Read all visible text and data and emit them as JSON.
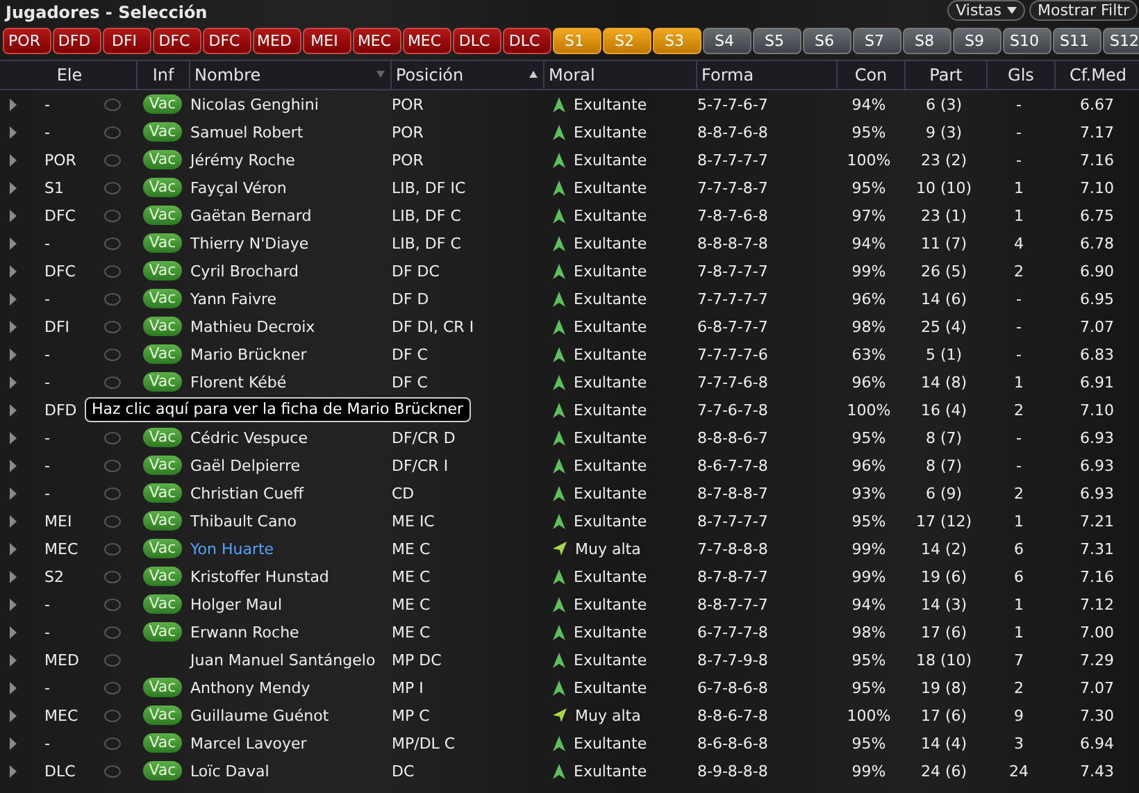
{
  "title": "Jugadores - Selección",
  "header_buttons": [
    {
      "label": "Vistas",
      "dropdown": true
    },
    {
      "label": "Mostrar Filtr",
      "dropdown": false
    }
  ],
  "slots": [
    {
      "label": "POR",
      "kind": "starter"
    },
    {
      "label": "DFD",
      "kind": "starter"
    },
    {
      "label": "DFI",
      "kind": "starter"
    },
    {
      "label": "DFC",
      "kind": "starter"
    },
    {
      "label": "DFC",
      "kind": "starter"
    },
    {
      "label": "MED",
      "kind": "starter"
    },
    {
      "label": "MEI",
      "kind": "starter"
    },
    {
      "label": "MEC",
      "kind": "starter"
    },
    {
      "label": "MEC",
      "kind": "starter"
    },
    {
      "label": "DLC",
      "kind": "starter"
    },
    {
      "label": "DLC",
      "kind": "starter"
    },
    {
      "label": "S1",
      "kind": "sub"
    },
    {
      "label": "S2",
      "kind": "sub"
    },
    {
      "label": "S3",
      "kind": "sub"
    },
    {
      "label": "S4",
      "kind": "empty"
    },
    {
      "label": "S5",
      "kind": "empty"
    },
    {
      "label": "S6",
      "kind": "empty"
    },
    {
      "label": "S7",
      "kind": "empty"
    },
    {
      "label": "S8",
      "kind": "empty"
    },
    {
      "label": "S9",
      "kind": "empty"
    },
    {
      "label": "S10",
      "kind": "empty"
    },
    {
      "label": "S11",
      "kind": "empty"
    },
    {
      "label": "S12",
      "kind": "empty"
    }
  ],
  "columns": [
    {
      "label": "Ele",
      "sorted": false
    },
    {
      "label": "Inf",
      "sorted": false
    },
    {
      "label": "Nombre",
      "sorted": true,
      "ascending": false
    },
    {
      "label": "Posición",
      "sorted": true,
      "ascending": true
    },
    {
      "label": "Moral",
      "sorted": false
    },
    {
      "label": "Forma",
      "sorted": false
    },
    {
      "label": "Con",
      "sorted": false
    },
    {
      "label": "Part",
      "sorted": false
    },
    {
      "label": "Gls",
      "sorted": false
    },
    {
      "label": "Cf.Med",
      "sorted": false
    }
  ],
  "rows": [
    {
      "ele": "-",
      "vac": "Vac",
      "name": "Nicolas Genghini",
      "highlighted": false,
      "position": "POR",
      "moral": {
        "kind": "up",
        "label": "Exultante"
      },
      "forma": "5-7-7-6-7",
      "con": "94%",
      "part": "6 (3)",
      "gls": "-",
      "cf": "6.67"
    },
    {
      "ele": "-",
      "vac": "Vac",
      "name": "Samuel Robert",
      "highlighted": false,
      "position": "POR",
      "moral": {
        "kind": "up",
        "label": "Exultante"
      },
      "forma": "8-8-7-6-8",
      "con": "95%",
      "part": "9 (3)",
      "gls": "-",
      "cf": "7.17"
    },
    {
      "ele": "POR",
      "vac": "Vac",
      "name": "Jérémy Roche",
      "highlighted": false,
      "position": "POR",
      "moral": {
        "kind": "up",
        "label": "Exultante"
      },
      "forma": "8-7-7-7-7",
      "con": "100%",
      "part": "23 (2)",
      "gls": "-",
      "cf": "7.16"
    },
    {
      "ele": "S1",
      "vac": "Vac",
      "name": "Fayçal Véron",
      "highlighted": false,
      "position": "LIB, DF IC",
      "moral": {
        "kind": "up",
        "label": "Exultante"
      },
      "forma": "7-7-7-8-7",
      "con": "95%",
      "part": "10 (10)",
      "gls": "1",
      "cf": "7.10"
    },
    {
      "ele": "DFC",
      "vac": "Vac",
      "name": "Gaëtan Bernard",
      "highlighted": false,
      "position": "LIB, DF C",
      "moral": {
        "kind": "up",
        "label": "Exultante"
      },
      "forma": "7-8-7-6-8",
      "con": "97%",
      "part": "23 (1)",
      "gls": "1",
      "cf": "6.75"
    },
    {
      "ele": "-",
      "vac": "Vac",
      "name": "Thierry N'Diaye",
      "highlighted": false,
      "position": "LIB, DF C",
      "moral": {
        "kind": "up",
        "label": "Exultante"
      },
      "forma": "8-8-8-7-8",
      "con": "94%",
      "part": "11 (7)",
      "gls": "4",
      "cf": "6.78"
    },
    {
      "ele": "DFC",
      "vac": "Vac",
      "name": "Cyril Brochard",
      "highlighted": false,
      "position": "DF DC",
      "moral": {
        "kind": "up",
        "label": "Exultante"
      },
      "forma": "7-8-7-7-7",
      "con": "99%",
      "part": "26 (5)",
      "gls": "2",
      "cf": "6.90"
    },
    {
      "ele": "-",
      "vac": "Vac",
      "name": "Yann Faivre",
      "highlighted": false,
      "position": "DF D",
      "moral": {
        "kind": "up",
        "label": "Exultante"
      },
      "forma": "7-7-7-7-7",
      "con": "96%",
      "part": "14 (6)",
      "gls": "-",
      "cf": "6.95"
    },
    {
      "ele": "DFI",
      "vac": "Vac",
      "name": "Mathieu Decroix",
      "highlighted": false,
      "position": "DF DI, CR I",
      "moral": {
        "kind": "up",
        "label": "Exultante"
      },
      "forma": "6-8-7-7-7",
      "con": "98%",
      "part": "25 (4)",
      "gls": "-",
      "cf": "7.07"
    },
    {
      "ele": "-",
      "vac": "Vac",
      "name": "Mario Brückner",
      "highlighted": false,
      "position": "DF C",
      "moral": {
        "kind": "up",
        "label": "Exultante"
      },
      "forma": "7-7-7-7-6",
      "con": "63%",
      "part": "5 (1)",
      "gls": "-",
      "cf": "6.83"
    },
    {
      "ele": "-",
      "vac": "Vac",
      "name": "Florent Kébé",
      "highlighted": false,
      "position": "DF C",
      "moral": {
        "kind": "up",
        "label": "Exultante"
      },
      "forma": "7-7-7-6-8",
      "con": "96%",
      "part": "14 (8)",
      "gls": "1",
      "cf": "6.91"
    },
    {
      "ele": "DFD",
      "tooltip": "Haz clic aquí para ver la ficha de Mario Brückner",
      "moral": {
        "kind": "up",
        "label": "Exultante"
      },
      "forma": "7-7-6-7-8",
      "con": "100%",
      "part": "16 (4)",
      "gls": "2",
      "cf": "7.10"
    },
    {
      "ele": "-",
      "vac": "Vac",
      "name": "Cédric Vespuce",
      "highlighted": false,
      "position": "DF/CR D",
      "moral": {
        "kind": "up",
        "label": "Exultante"
      },
      "forma": "8-8-8-6-7",
      "con": "95%",
      "part": "8 (7)",
      "gls": "-",
      "cf": "6.93"
    },
    {
      "ele": "-",
      "vac": "Vac",
      "name": "Gaël Delpierre",
      "highlighted": false,
      "position": "DF/CR I",
      "moral": {
        "kind": "up",
        "label": "Exultante"
      },
      "forma": "8-6-7-7-8",
      "con": "96%",
      "part": "8 (7)",
      "gls": "-",
      "cf": "6.93"
    },
    {
      "ele": "-",
      "vac": "Vac",
      "name": "Christian Cueff",
      "highlighted": false,
      "position": "CD",
      "moral": {
        "kind": "up",
        "label": "Exultante"
      },
      "forma": "8-7-8-8-7",
      "con": "93%",
      "part": "6 (9)",
      "gls": "2",
      "cf": "6.93"
    },
    {
      "ele": "MEI",
      "vac": "Vac",
      "name": "Thibault Cano",
      "highlighted": false,
      "position": "ME IC",
      "moral": {
        "kind": "up",
        "label": "Exultante"
      },
      "forma": "8-7-7-7-7",
      "con": "95%",
      "part": "17 (12)",
      "gls": "1",
      "cf": "7.21"
    },
    {
      "ele": "MEC",
      "vac": "Vac",
      "name": "Yon Huarte",
      "highlighted": true,
      "position": "ME C",
      "moral": {
        "kind": "diagonal",
        "label": "Muy alta"
      },
      "forma": "7-7-8-8-8",
      "con": "99%",
      "part": "14 (2)",
      "gls": "6",
      "cf": "7.31"
    },
    {
      "ele": "S2",
      "vac": "Vac",
      "name": "Kristoffer Hunstad",
      "highlighted": false,
      "position": "ME C",
      "moral": {
        "kind": "up",
        "label": "Exultante"
      },
      "forma": "8-7-8-7-7",
      "con": "99%",
      "part": "19 (6)",
      "gls": "6",
      "cf": "7.16"
    },
    {
      "ele": "-",
      "vac": "Vac",
      "name": "Holger Maul",
      "highlighted": false,
      "position": "ME C",
      "moral": {
        "kind": "up",
        "label": "Exultante"
      },
      "forma": "8-8-7-7-7",
      "con": "94%",
      "part": "14 (3)",
      "gls": "1",
      "cf": "7.12"
    },
    {
      "ele": "-",
      "vac": "Vac",
      "name": "Erwann Roche",
      "highlighted": false,
      "position": "ME C",
      "moral": {
        "kind": "up",
        "label": "Exultante"
      },
      "forma": "6-7-7-7-8",
      "con": "98%",
      "part": "17 (6)",
      "gls": "1",
      "cf": "7.00"
    },
    {
      "ele": "MED",
      "name": "Juan Manuel Santángelo",
      "highlighted": false,
      "position": "MP DC",
      "moral": {
        "kind": "up",
        "label": "Exultante"
      },
      "forma": "8-7-7-9-8",
      "con": "95%",
      "part": "18 (10)",
      "gls": "7",
      "cf": "7.29"
    },
    {
      "ele": "-",
      "vac": "Vac",
      "name": "Anthony Mendy",
      "highlighted": false,
      "position": "MP I",
      "moral": {
        "kind": "up",
        "label": "Exultante"
      },
      "forma": "6-7-8-6-8",
      "con": "95%",
      "part": "19 (8)",
      "gls": "2",
      "cf": "7.07"
    },
    {
      "ele": "MEC",
      "vac": "Vac",
      "name": "Guillaume Guénot",
      "highlighted": false,
      "position": "MP C",
      "moral": {
        "kind": "diagonal",
        "label": "Muy alta"
      },
      "forma": "8-8-6-7-8",
      "con": "100%",
      "part": "17 (6)",
      "gls": "9",
      "cf": "7.30"
    },
    {
      "ele": "-",
      "vac": "Vac",
      "name": "Marcel Lavoyer",
      "highlighted": false,
      "position": "MP/DL C",
      "moral": {
        "kind": "up",
        "label": "Exultante"
      },
      "forma": "8-6-8-6-8",
      "con": "95%",
      "part": "14 (4)",
      "gls": "3",
      "cf": "6.94"
    },
    {
      "ele": "DLC",
      "vac": "Vac",
      "name": "Loïc Daval",
      "highlighted": false,
      "position": "DC",
      "moral": {
        "kind": "up",
        "label": "Exultante"
      },
      "forma": "8-9-8-8-8",
      "con": "99%",
      "part": "24 (6)",
      "gls": "24",
      "cf": "7.43"
    }
  ]
}
